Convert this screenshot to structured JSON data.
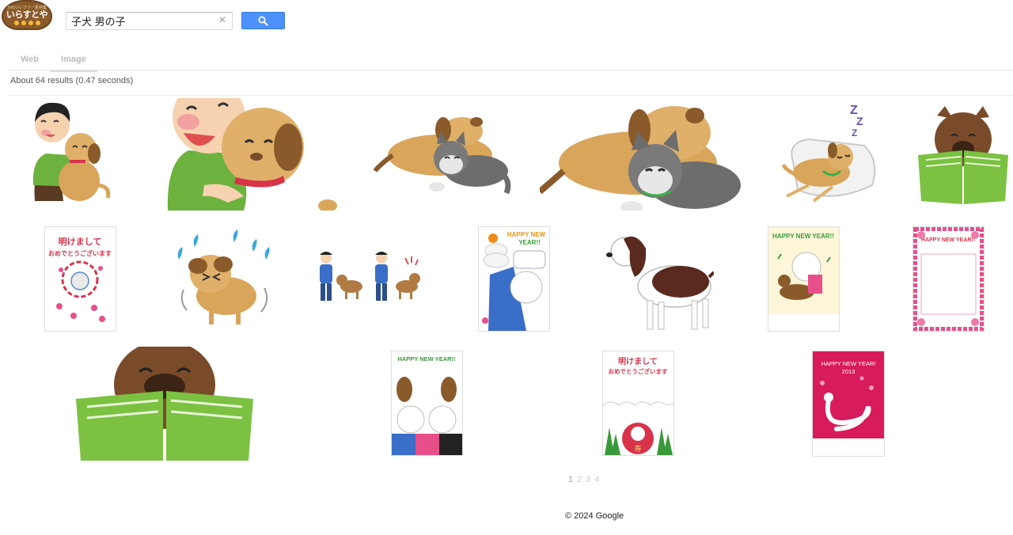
{
  "logo": {
    "tagline": "かわいいフリー素材集",
    "name": "いらすとや"
  },
  "search": {
    "query": "子犬 男の子",
    "clear_label": "×"
  },
  "tabs": [
    {
      "label": "Web"
    },
    {
      "label": "Image"
    }
  ],
  "results": {
    "stats": "About 64 results (0.47 seconds)"
  },
  "thumbnails": {
    "card_new_year_1": {
      "line1": "明けまして",
      "line2": "おめでとうございます"
    },
    "card_happy_1": {
      "title": "HAPPY NEW",
      "title2": "YEAR!!"
    },
    "card_happy_2": {
      "title": "HAPPY NEW YEAR!!"
    },
    "card_happy_3": {
      "title": "HAPPY NEW YEAR!!"
    },
    "card_happy_4": {
      "title": "HAPPY NEW YEAR!!"
    },
    "card_new_year_2": {
      "line1": "明けまして",
      "line2": "おめでとうございます",
      "stamp": "寿"
    },
    "card_snake": {
      "title": "HAPPY NEW YEAR!",
      "year": "2013"
    }
  },
  "pagination": {
    "pages": [
      "1",
      "2",
      "3",
      "4"
    ]
  },
  "footer": {
    "copyright": "© 2024 Google"
  },
  "colors": {
    "search_button": "#4d90fe",
    "logo_brown": "#8a5a2b"
  }
}
